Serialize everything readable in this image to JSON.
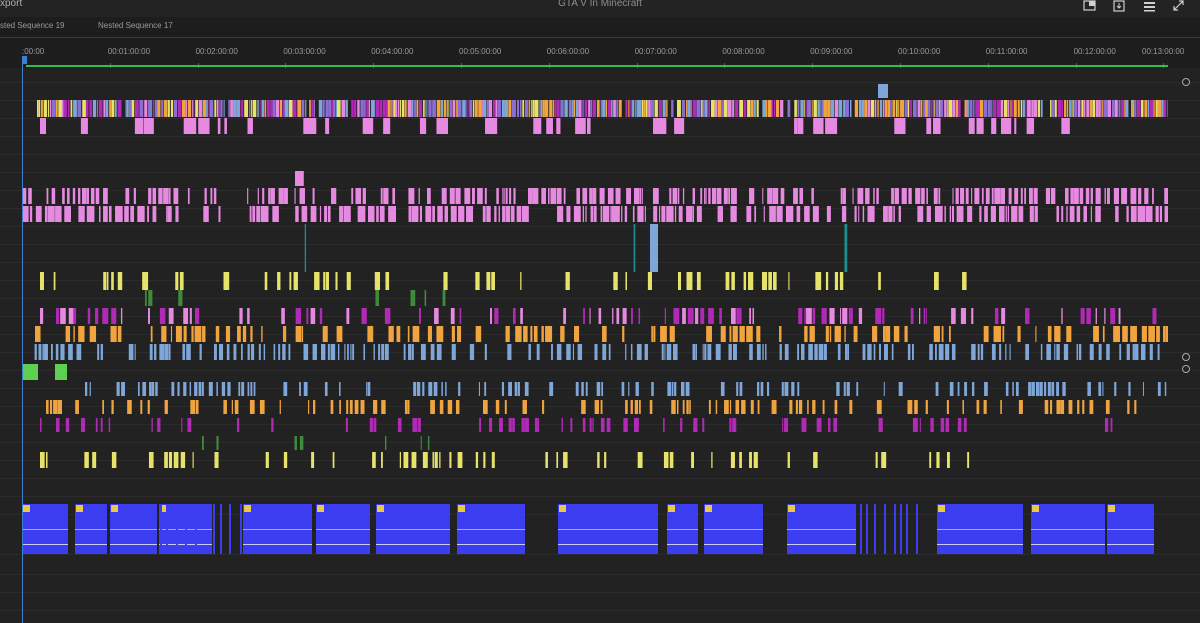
{
  "app": {
    "export_label": "xport",
    "window_title": "GTA V In Minecraft",
    "tabs": [
      {
        "label": "sted Sequence 19"
      },
      {
        "label": "Nested Sequence 17"
      }
    ]
  },
  "ruler": {
    "labels": [
      ":00:00",
      "00:01:00:00",
      "00:02:00:00",
      "00:03:00:00",
      "00:04:00:00",
      "00:05:00:00",
      "00:06:00:00",
      "00:07:00:00",
      "00:08:00:00",
      "00:09:00:00",
      "00:10:00:00",
      "00:11:00:00",
      "00:12:00:00",
      "00:13:00:00"
    ]
  },
  "colors": {
    "background": "#222222",
    "clip_pink": "#e58ae0",
    "clip_magenta": "#b02ab5",
    "clip_yellow": "#e6e26a",
    "clip_orange": "#f0a440",
    "clip_blue": "#7fa6d8",
    "clip_green": "#3f8a3b",
    "clip_teal": "#1e8f8f",
    "audio_clip": "#3c3cf0",
    "playhead": "#3d7fd0",
    "work_area": "#2fbf4a"
  },
  "icons": {
    "top_right": [
      "export-frame-icon",
      "settings-icon",
      "menu-icon",
      "expand-icon"
    ],
    "clip_badge": "fx-icon"
  }
}
